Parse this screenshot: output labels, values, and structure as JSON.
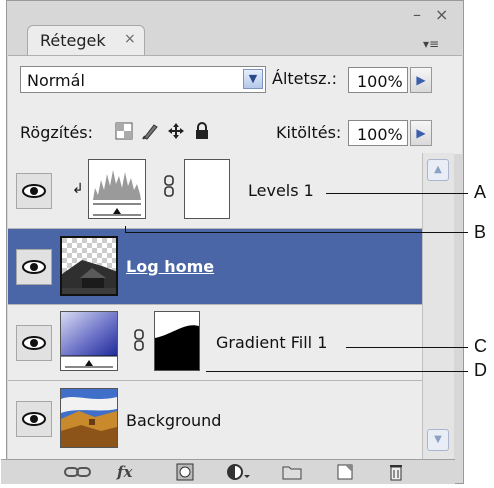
{
  "window": {
    "minimize_symbol": "–",
    "close_symbol": "×"
  },
  "tab": {
    "label": "Rétegek",
    "close_symbol": "×",
    "menu_symbol": "▾≡"
  },
  "blend": {
    "value": "Normál",
    "arrow_symbol": "▼"
  },
  "opacity": {
    "label": "Áltetsz.:",
    "value": "100%",
    "arrow_symbol": "▶"
  },
  "lock": {
    "label": "Rögzítés:",
    "icons": [
      "lock-transparent-pixels-icon",
      "lock-image-pixels-icon",
      "lock-position-icon",
      "lock-all-icon"
    ]
  },
  "fill": {
    "label": "Kitöltés:",
    "value": "100%",
    "arrow_symbol": "▶"
  },
  "layers": [
    {
      "name": "Levels 1",
      "visible": true,
      "selected": false,
      "clipped": true,
      "clip_symbol": "↲",
      "thumb": "levels-adjustment-icon",
      "has_mask": true
    },
    {
      "name": "Log home",
      "visible": true,
      "selected": true,
      "thumb": "log-home-photo"
    },
    {
      "name": "Gradient Fill 1",
      "visible": true,
      "selected": false,
      "thumb": "gradient-fill-icon",
      "has_mask": true
    },
    {
      "name": "Background",
      "visible": true,
      "selected": false,
      "thumb": "background-landscape-photo"
    }
  ],
  "scroll": {
    "up_symbol": "▲",
    "down_symbol": "▼"
  },
  "bottom_bar": {
    "icons": [
      "link-layers-icon",
      "fx-icon",
      "add-mask-icon",
      "adjustment-layer-icon",
      "new-group-icon",
      "new-layer-icon",
      "trash-icon"
    ],
    "fx_label": "fx"
  },
  "callouts": [
    "A",
    "B",
    "C",
    "D"
  ]
}
